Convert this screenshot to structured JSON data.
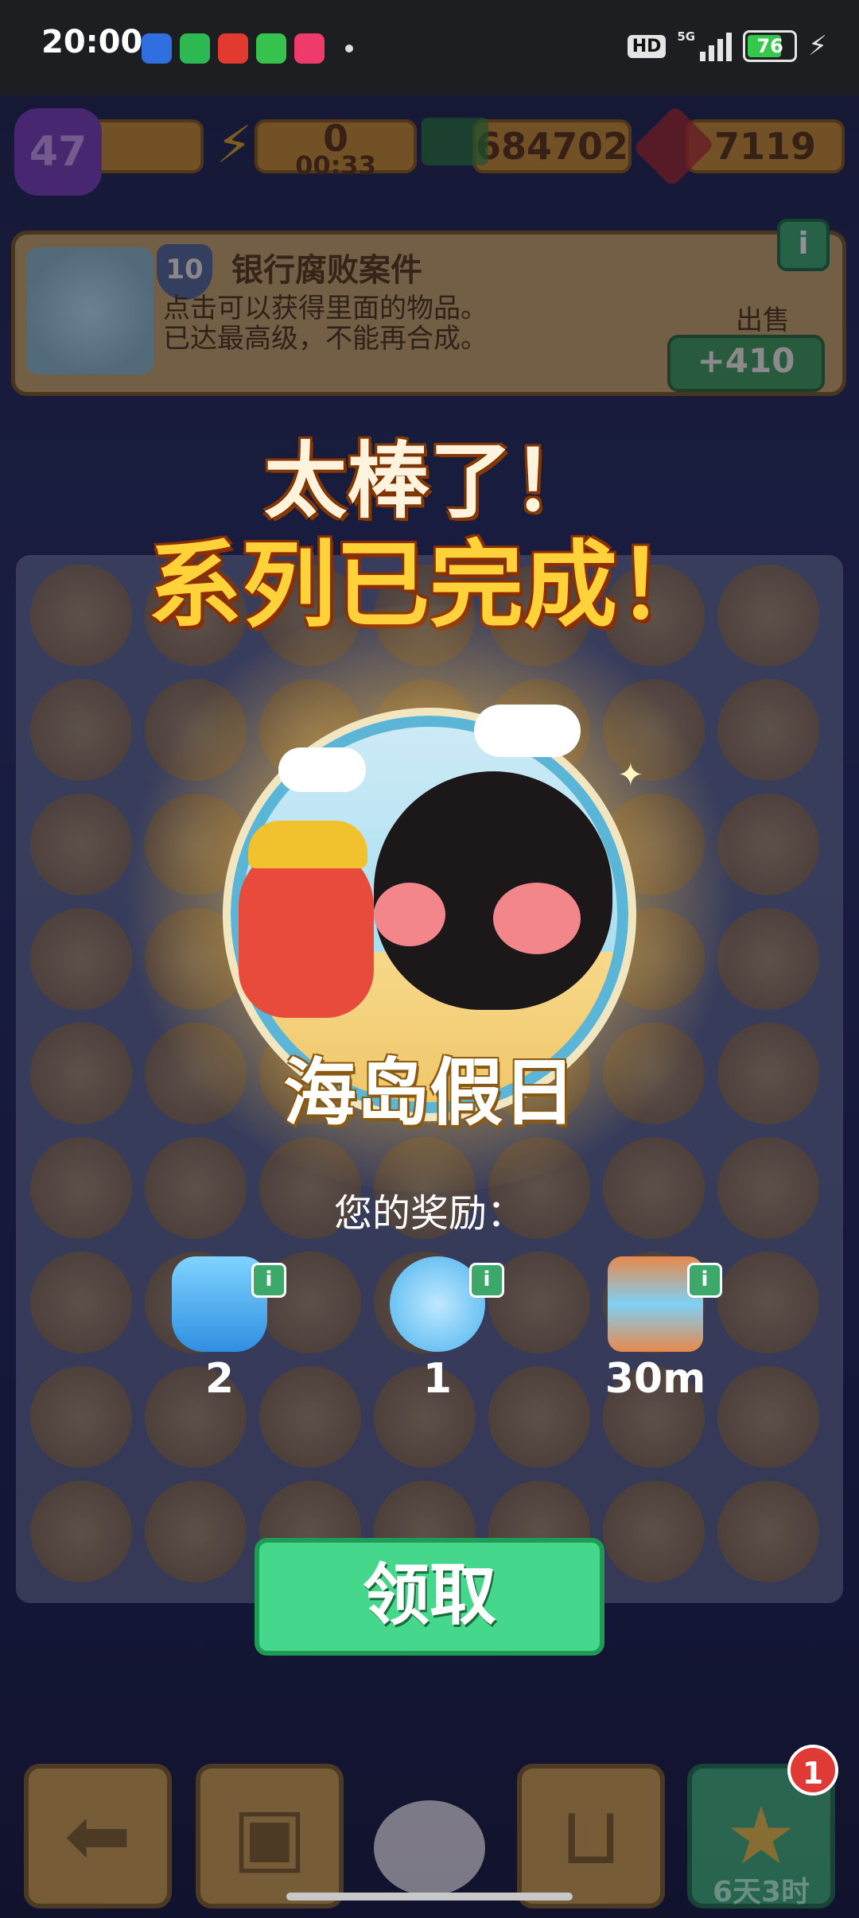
{
  "status_bar": {
    "time": "20:00",
    "hd": "HD",
    "network": "5G",
    "battery": "76"
  },
  "resources": {
    "level": "47",
    "energy": "0",
    "energy_timer": "00:33",
    "cash": "684702",
    "gems": "7119"
  },
  "item_panel": {
    "level": "10",
    "title": "银行腐败案件",
    "desc_line1": "点击可以获得里面的物品。",
    "desc_line2": "已达最高级，不能再合成。",
    "sell_label": "出售",
    "sell_value": "+410",
    "info_icon": "i"
  },
  "popup": {
    "headline1": "太棒了！",
    "headline2": "系列已完成！",
    "series_name": "海岛假日",
    "reward_title": "您的奖励：",
    "rewards": [
      {
        "icon": "energy-bottle-icon",
        "value": "2",
        "info": "i"
      },
      {
        "icon": "scissors-icon",
        "value": "1",
        "info": "i"
      },
      {
        "icon": "hourglass-icon",
        "value": "30m",
        "info": "i"
      }
    ],
    "claim_label": "领取"
  },
  "bottom_nav": {
    "badge": "1",
    "timer": "6天3时"
  },
  "colors": {
    "claim_green": "#45d88c",
    "headline_yellow": "#ffd23a",
    "panel_tan": "#c9a464"
  }
}
